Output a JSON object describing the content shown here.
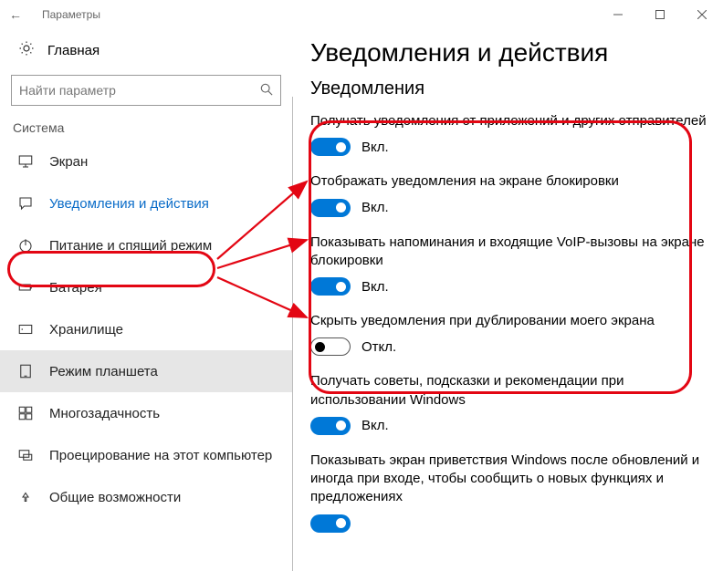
{
  "window": {
    "title": "Параметры"
  },
  "home_label": "Главная",
  "search_placeholder": "Найти параметр",
  "section": "Система",
  "nav": [
    {
      "icon": "monitor",
      "label": "Экран"
    },
    {
      "icon": "notify",
      "label": "Уведомления и действия",
      "selected": true
    },
    {
      "icon": "power",
      "label": "Питание и спящий режим"
    },
    {
      "icon": "battery",
      "label": "Батарея"
    },
    {
      "icon": "storage",
      "label": "Хранилище"
    },
    {
      "icon": "tablet",
      "label": "Режим планшета",
      "highlight": true
    },
    {
      "icon": "multi",
      "label": "Многозадачность"
    },
    {
      "icon": "project",
      "label": "Проецирование на этот компьютер"
    },
    {
      "icon": "shared",
      "label": "Общие возможности"
    }
  ],
  "page": {
    "title": "Уведомления и действия",
    "subheading": "Уведомления"
  },
  "settings": [
    {
      "label": "Получать уведомления от приложений и других отправителей",
      "on": true,
      "state": "Вкл."
    },
    {
      "label": "Отображать уведомления на экране блокировки",
      "on": true,
      "state": "Вкл."
    },
    {
      "label": "Показывать напоминания и входящие VoIP-вызовы на экране блокировки",
      "on": true,
      "state": "Вкл."
    },
    {
      "label": "Скрыть уведомления при дублировании моего экрана",
      "on": false,
      "state": "Откл."
    },
    {
      "label": "Получать советы, подсказки и рекомендации при использовании Windows",
      "on": true,
      "state": "Вкл."
    },
    {
      "label": "Показывать экран приветствия Windows после обновлений и иногда при входе, чтобы сообщить о новых функциях и предложениях",
      "on": true,
      "state": ""
    }
  ]
}
